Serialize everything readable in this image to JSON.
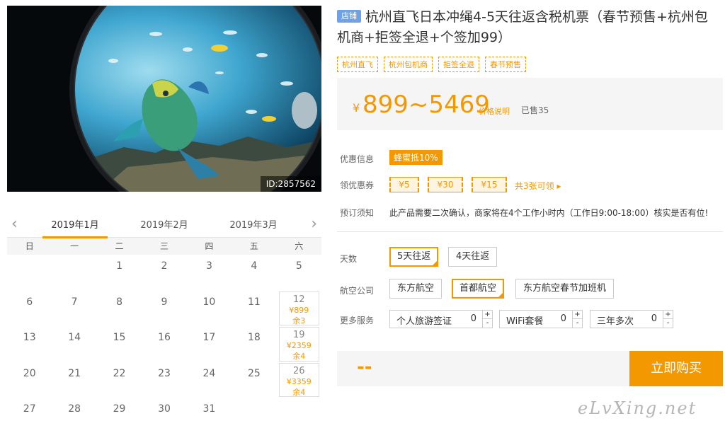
{
  "photo": {
    "id_label": "ID:2857562"
  },
  "calendar": {
    "months": [
      "2019年1月",
      "2019年2月",
      "2019年3月"
    ],
    "weekdays": [
      "日",
      "一",
      "二",
      "三",
      "四",
      "五",
      "六"
    ],
    "prev_arrow": "‹",
    "next_arrow": "›",
    "days": [
      "",
      "",
      "1",
      "2",
      "3",
      "4",
      "5",
      "6",
      "7",
      "8",
      "9",
      "10",
      "11",
      "12",
      "13",
      "14",
      "15",
      "16",
      "17",
      "18",
      "19",
      "20",
      "21",
      "22",
      "23",
      "24",
      "25",
      "26",
      "27",
      "28",
      "29",
      "30",
      "31"
    ],
    "avail": {
      "d12": {
        "day": "12",
        "price": "¥899",
        "stock": "余3"
      },
      "d19": {
        "day": "19",
        "price": "¥2359",
        "stock": "余4"
      },
      "d26": {
        "day": "26",
        "price": "¥3359",
        "stock": "余4"
      }
    }
  },
  "product": {
    "shop_badge": "店铺",
    "title": "杭州直飞日本冲绳4-5天往返含税机票（春节预售+杭州包机商+拒签全退+个签加99）",
    "tags": [
      "杭州直飞",
      "杭州包机商",
      "拒签全退",
      "春节预售"
    ],
    "price_yen": "¥",
    "price_range": "899~5469",
    "price_explain": "价格说明",
    "sold": "已售35"
  },
  "info": {
    "promo_label": "优惠信息",
    "promo_badge": "蜂蜜抵10%",
    "coupon_label": "领优惠券",
    "coupons": [
      "¥5",
      "¥30",
      "¥15"
    ],
    "coupon_more": "共3张可领 ▸",
    "notice_label": "预订须知",
    "notice_text": "此产品需要二次确认，商家将在4个工作小时内（工作日9:00-18:00）核实是否有位!"
  },
  "options": {
    "days_label": "天数",
    "days": [
      "5天往返",
      "4天往返"
    ],
    "airline_label": "航空公司",
    "airlines": [
      "东方航空",
      "首都航空",
      "东方航空春节加班机"
    ],
    "services_label": "更多服务",
    "services": [
      {
        "name": "个人旅游签证",
        "qty": "0"
      },
      {
        "name": "WiFi套餐",
        "qty": "0"
      },
      {
        "name": "三年多次",
        "qty": "0"
      }
    ],
    "plus": "+",
    "minus": "-"
  },
  "buy": {
    "price_placeholder": "--",
    "button": "立即购买"
  },
  "watermark": "eLvXing.net",
  "colors": {
    "accent": "#f39800",
    "badge_blue": "#6fa1e6"
  }
}
